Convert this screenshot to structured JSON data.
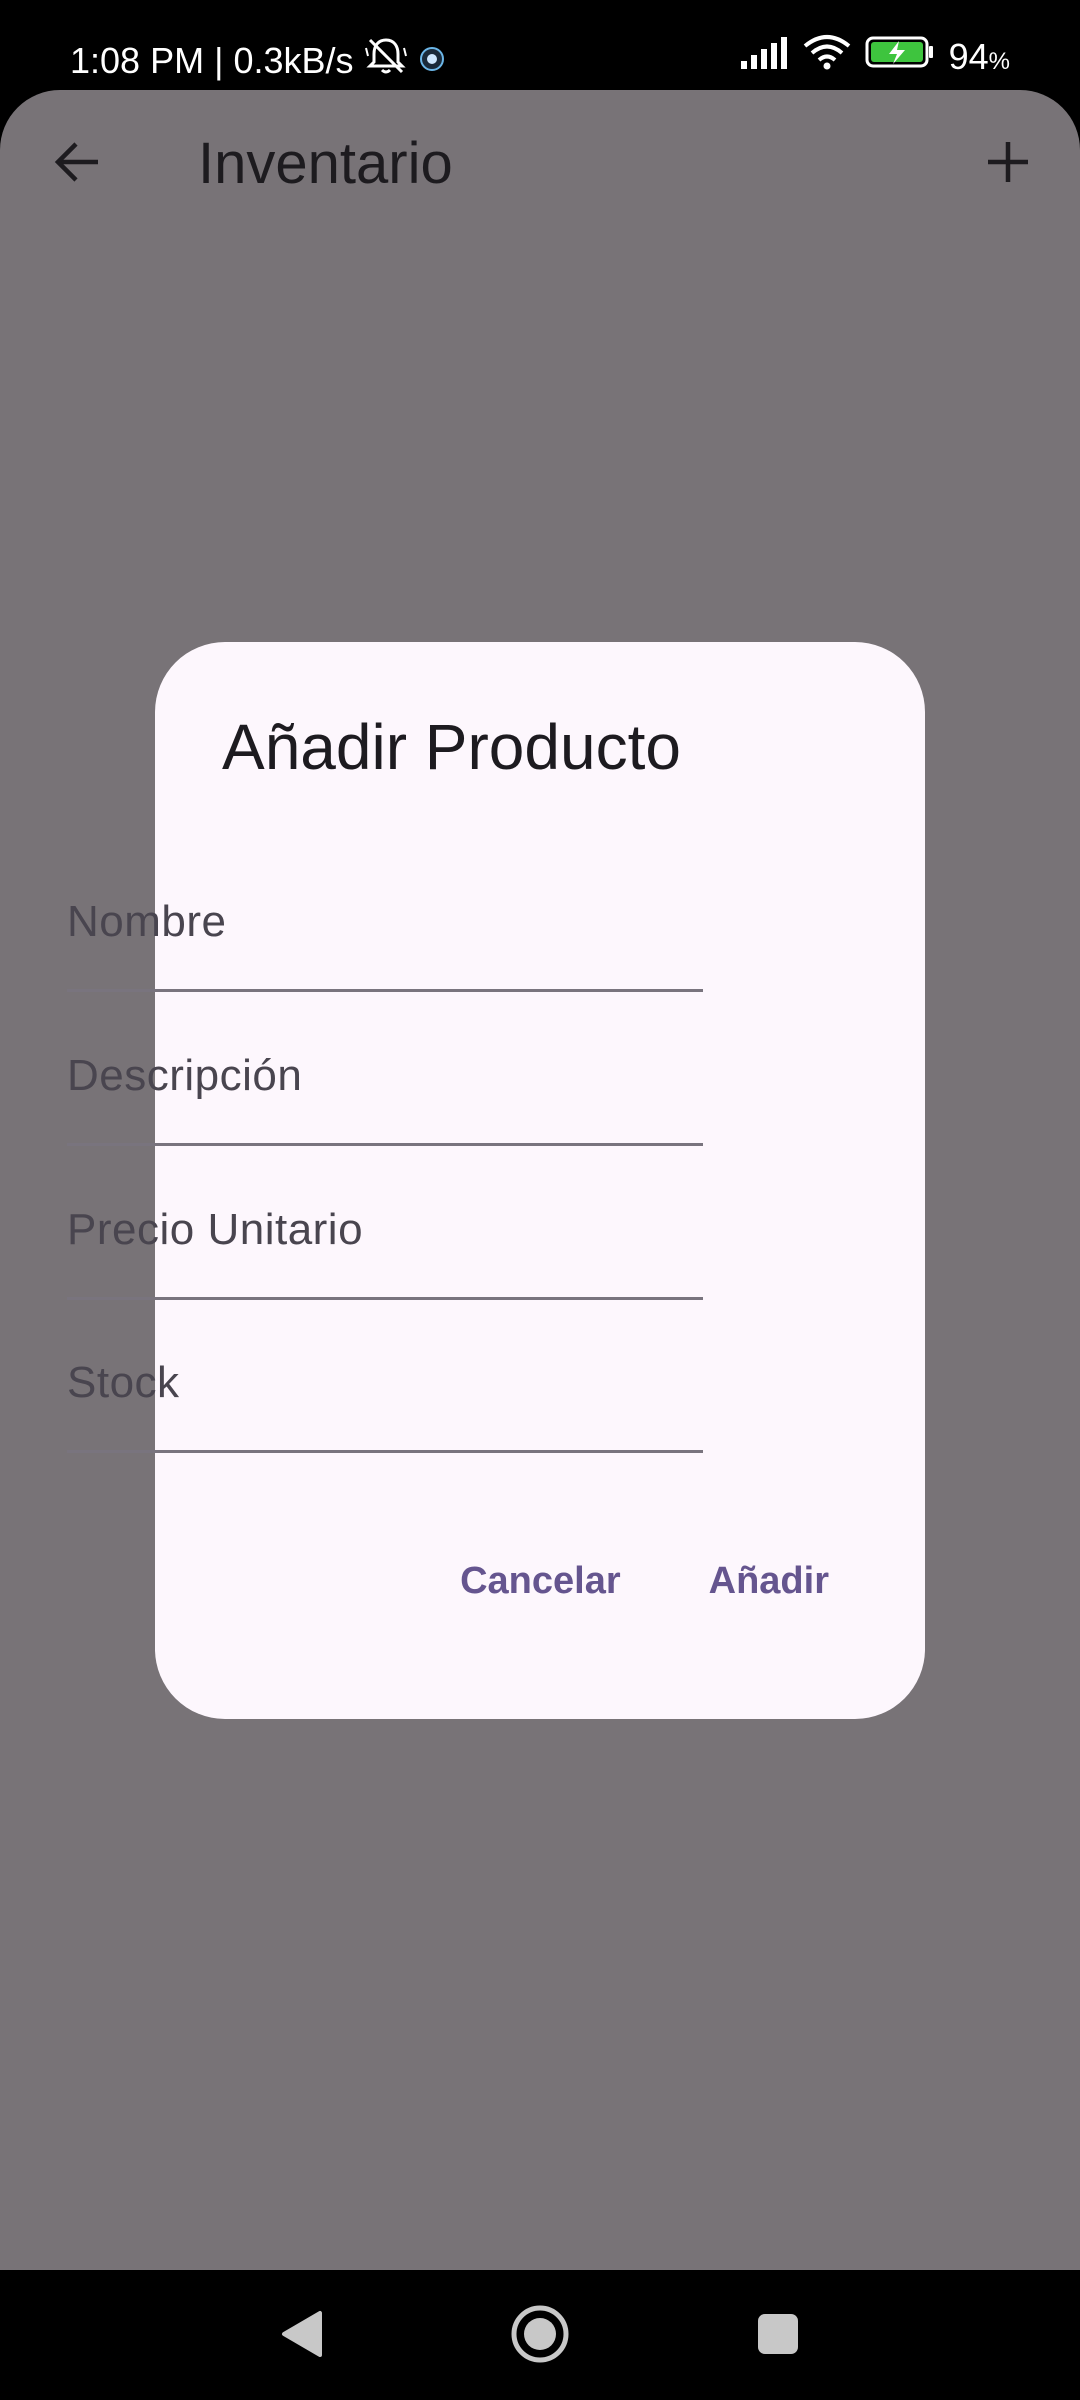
{
  "status_bar": {
    "time": "1:08 PM",
    "separator": "|",
    "net_speed": "0.3kB/s",
    "battery_percent": "94",
    "battery_unit": "%",
    "icons": [
      "mute-notifications-icon",
      "app-notification-icon",
      "signal-icon",
      "wifi-icon",
      "battery-charging-icon"
    ]
  },
  "app_bar": {
    "title": "Inventario",
    "back_icon": "arrow-back-icon",
    "add_icon": "plus-icon"
  },
  "dialog": {
    "title": "Añadir Producto",
    "fields": [
      {
        "placeholder": "Nombre",
        "value": ""
      },
      {
        "placeholder": "Descripción",
        "value": ""
      },
      {
        "placeholder": "Precio Unitario",
        "value": ""
      },
      {
        "placeholder": "Stock",
        "value": ""
      }
    ],
    "cancel_label": "Cancelar",
    "confirm_label": "Añadir"
  },
  "colors": {
    "scrim": "#787377",
    "dialog_bg": "#fdf7fd",
    "accent": "#65558f",
    "underline": "#79747e"
  },
  "nav_bar": {
    "icons": [
      "nav-back-icon",
      "nav-home-icon",
      "nav-recents-icon"
    ]
  }
}
